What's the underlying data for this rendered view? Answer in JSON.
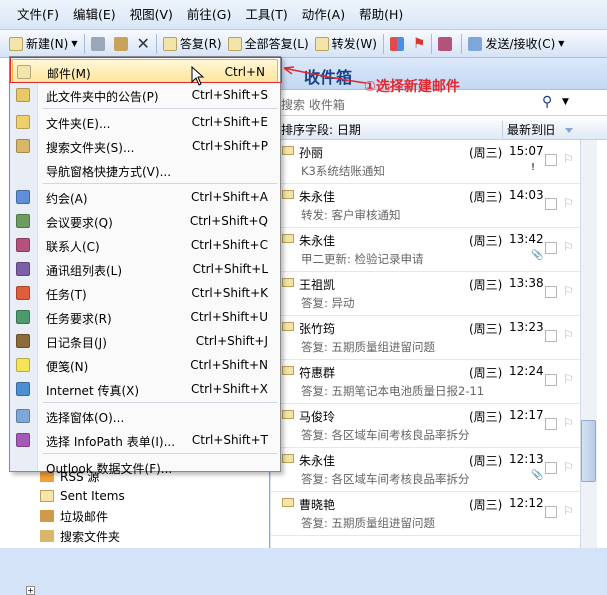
{
  "menubar": [
    "文件(F)",
    "编辑(E)",
    "视图(V)",
    "前往(G)",
    "工具(T)",
    "动作(A)",
    "帮助(H)"
  ],
  "toolbar": {
    "new_label": "新建(N)",
    "reply_label": "答复(R)",
    "reply_all_label": "全部答复(L)",
    "forward_label": "转发(W)",
    "send_receive_label": "发送/接收(C)"
  },
  "new_menu": [
    {
      "label": "邮件(M)",
      "shortcut": "Ctrl+N",
      "icon": "mail-icon",
      "highlight": true
    },
    {
      "label": "此文件夹中的公告(P)",
      "shortcut": "Ctrl+Shift+S",
      "icon": "post-icon"
    },
    {
      "sep": true
    },
    {
      "label": "文件夹(E)...",
      "shortcut": "Ctrl+Shift+E",
      "icon": "folder-icon"
    },
    {
      "label": "搜索文件夹(S)...",
      "shortcut": "Ctrl+Shift+P",
      "icon": "search-folder-icon"
    },
    {
      "label": "导航窗格快捷方式(V)...",
      "shortcut": "",
      "icon": ""
    },
    {
      "sep": true
    },
    {
      "label": "约会(A)",
      "shortcut": "Ctrl+Shift+A",
      "icon": "appointment-icon"
    },
    {
      "label": "会议要求(Q)",
      "shortcut": "Ctrl+Shift+Q",
      "icon": "meeting-icon"
    },
    {
      "label": "联系人(C)",
      "shortcut": "Ctrl+Shift+C",
      "icon": "contact-icon"
    },
    {
      "label": "通讯组列表(L)",
      "shortcut": "Ctrl+Shift+L",
      "icon": "distribution-list-icon"
    },
    {
      "label": "任务(T)",
      "shortcut": "Ctrl+Shift+K",
      "icon": "task-icon"
    },
    {
      "label": "任务要求(R)",
      "shortcut": "Ctrl+Shift+U",
      "icon": "task-request-icon"
    },
    {
      "label": "日记条目(J)",
      "shortcut": "Ctrl+Shift+J",
      "icon": "journal-icon"
    },
    {
      "label": "便笺(N)",
      "shortcut": "Ctrl+Shift+N",
      "icon": "note-icon"
    },
    {
      "label": "Internet 传真(X)",
      "shortcut": "Ctrl+Shift+X",
      "icon": "fax-icon"
    },
    {
      "sep": true
    },
    {
      "label": "选择窗体(O)...",
      "shortcut": "",
      "icon": "form-icon"
    },
    {
      "label": "选择 InfoPath 表单(I)...",
      "shortcut": "Ctrl+Shift+T",
      "icon": "infopath-icon"
    },
    {
      "sep": true
    },
    {
      "label": "Outlook 数据文件(F)...",
      "shortcut": "",
      "icon": ""
    }
  ],
  "annotation": "①选择新建邮件",
  "inbox": {
    "title": "收件箱",
    "search_placeholder": "搜索 收件箱",
    "arrange_label": "排序字段: 日期",
    "sort_label": "最新到旧"
  },
  "mails": [
    {
      "from": "孙丽",
      "day": "(周三)",
      "time": "15:07",
      "subject": "K3系统结账通知",
      "mark": "!"
    },
    {
      "from": "朱永佳",
      "day": "(周三)",
      "time": "14:03",
      "subject": "转发: 客户审核通知",
      "mark": ""
    },
    {
      "from": "朱永佳",
      "day": "(周三)",
      "time": "13:42",
      "subject": "甲二更新: 检验记录申请",
      "mark": "📎"
    },
    {
      "from": "王祖凯",
      "day": "(周三)",
      "time": "13:38",
      "subject": "答复: 异动",
      "mark": ""
    },
    {
      "from": "张竹筠",
      "day": "(周三)",
      "time": "13:23",
      "subject": "答复: 五期质量组进留问题",
      "mark": ""
    },
    {
      "from": "符惠群",
      "day": "(周三)",
      "time": "12:24",
      "subject": "答复: 五期笔记本电池质量日报2-11",
      "mark": ""
    },
    {
      "from": "马俊玲",
      "day": "(周三)",
      "time": "12:17",
      "subject": "答复: 各区域车间考核良品率拆分",
      "mark": ""
    },
    {
      "from": "朱永佳",
      "day": "(周三)",
      "time": "12:13",
      "subject": "答复: 各区域车间考核良品率拆分",
      "mark": "📎"
    },
    {
      "from": "曹晓艳",
      "day": "(周三)",
      "time": "12:12",
      "subject": "答复: 五期质量组进留问题",
      "mark": ""
    }
  ],
  "nav": [
    {
      "label": "RSS 源",
      "icon": "rss-icon"
    },
    {
      "label": "Sent Items",
      "icon": "sent-items-icon"
    },
    {
      "label": "垃圾邮件",
      "icon": "junk-icon"
    },
    {
      "label": "搜索文件夹",
      "icon": "search-folder-icon"
    }
  ]
}
